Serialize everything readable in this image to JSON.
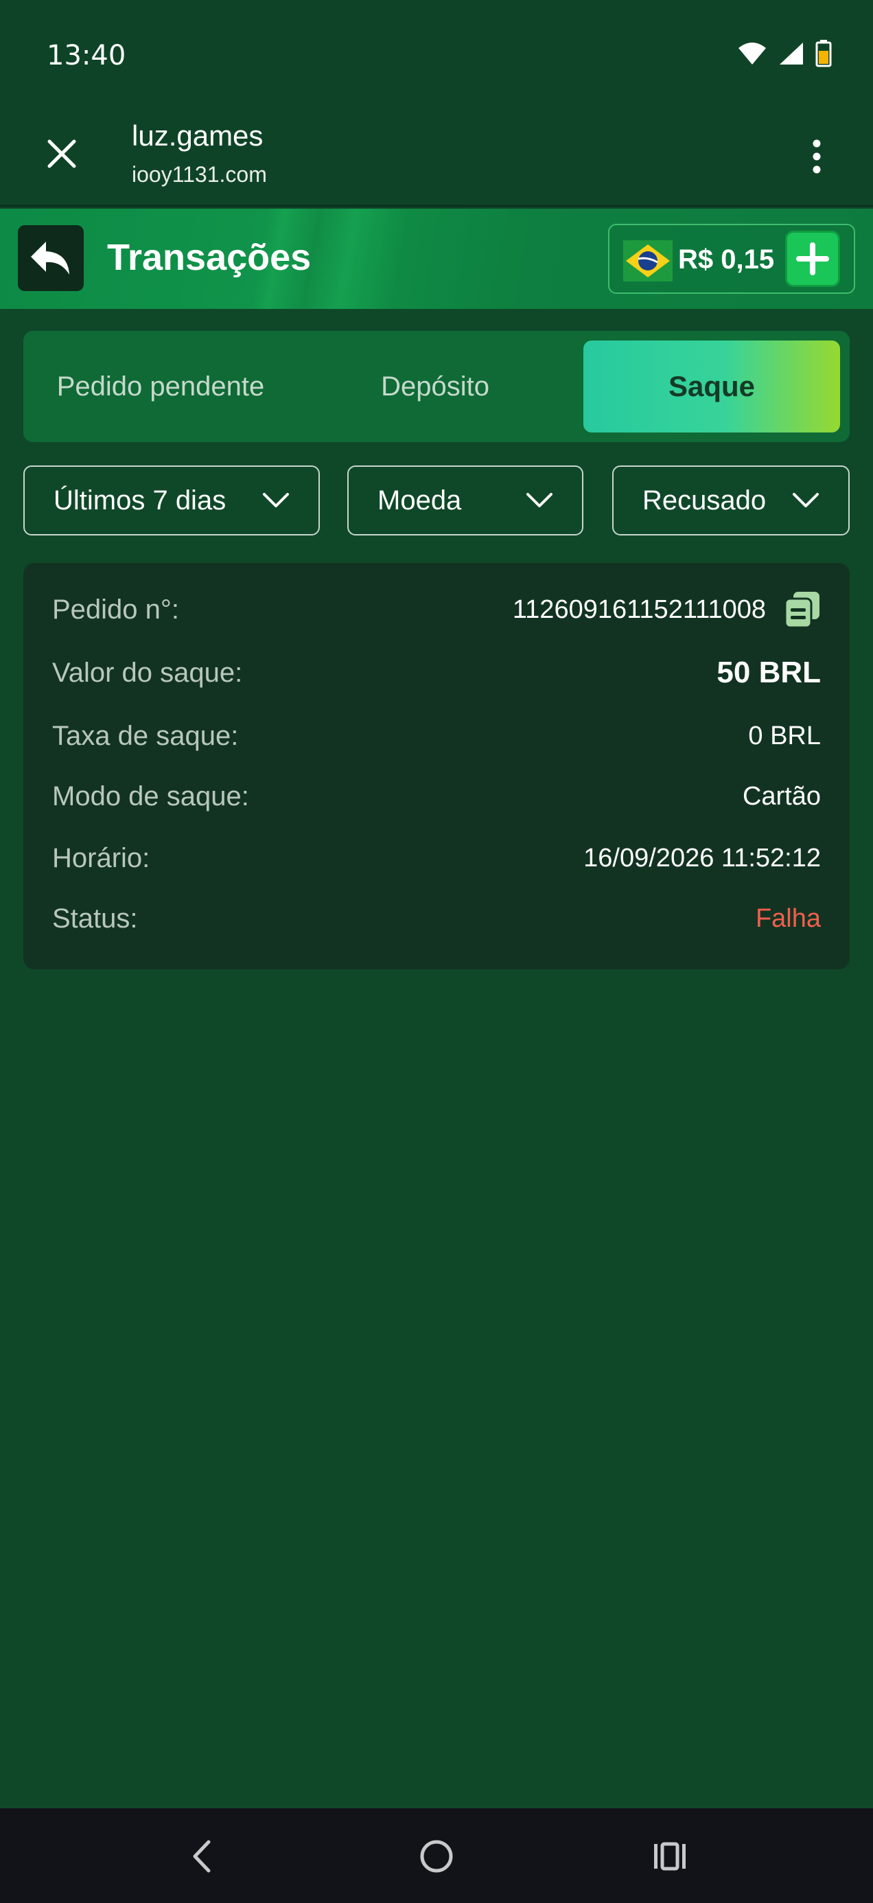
{
  "status_bar": {
    "time": "13:40",
    "icons": [
      "wifi-icon",
      "signal-icon",
      "battery-icon"
    ]
  },
  "browser": {
    "title": "luz.games",
    "url": "iooy1131.com",
    "icons": [
      "close-icon",
      "more-vert-icon"
    ]
  },
  "header": {
    "title": "Transações",
    "balance": "R$ 0,15",
    "icons": [
      "back-icon",
      "brazil-flag-icon",
      "plus-icon"
    ]
  },
  "tabs": [
    {
      "label": "Pedido pendente",
      "active": false
    },
    {
      "label": "Depósito",
      "active": false
    },
    {
      "label": "Saque",
      "active": true
    }
  ],
  "filters": {
    "period": "Últimos 7 dias",
    "currency": "Moeda",
    "status": "Recusado"
  },
  "transaction": {
    "order_label": "Pedido n°:",
    "order_value": "112609161152111008",
    "amount_label": "Valor do saque:",
    "amount_value": "50 BRL",
    "fee_label": "Taxa de saque:",
    "fee_value": "0 BRL",
    "mode_label": "Modo de saque:",
    "mode_value": "Cartão",
    "time_label": "Horário:",
    "time_value": "16/09/2026 11:52:12",
    "status_label": "Status:",
    "status_value": "Falha"
  },
  "colors": {
    "background": "#0f4829",
    "header": "#0d8a45",
    "accent_start": "#27ca9e",
    "accent_end": "#96d931",
    "fail": "#f25f4c"
  }
}
